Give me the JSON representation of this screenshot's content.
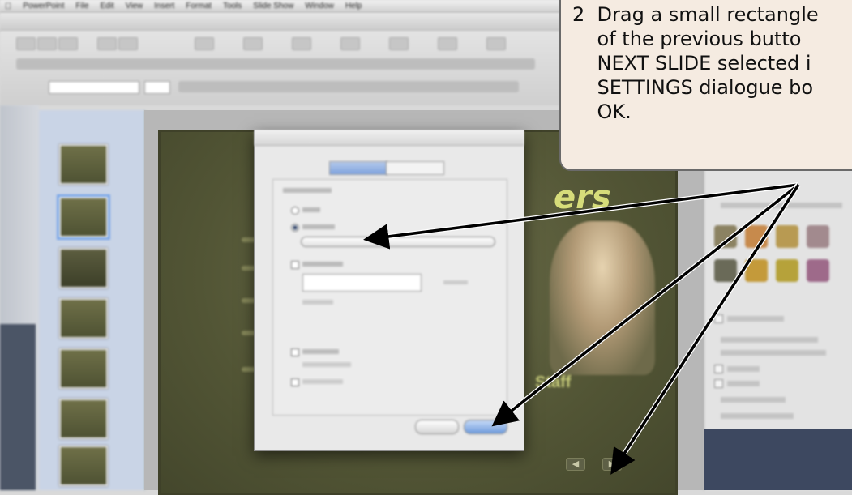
{
  "menubar": {
    "items": [
      "PowerPoint",
      "File",
      "Edit",
      "View",
      "Insert",
      "Format",
      "Tools",
      "Slide Show",
      "Window",
      "Help"
    ]
  },
  "callout": {
    "text": "2  Drag a small rectangle\n    of the previous butto\n    NEXT SLIDE selected i\n    SETTINGS dialogue bo\n    OK."
  },
  "slide": {
    "title_left": "",
    "title_right": "ers",
    "subtitle": "Staff",
    "prev_icon": "left-arrow-icon",
    "next_icon": "right-arrow-icon"
  },
  "dialog": {
    "default_button_color": "#6f9bdc"
  },
  "colors": {
    "slide_bg": "#525535",
    "slide_title": "#d6dc7a",
    "callout_bg": "#f5ebe1",
    "arrow": "#000000"
  }
}
